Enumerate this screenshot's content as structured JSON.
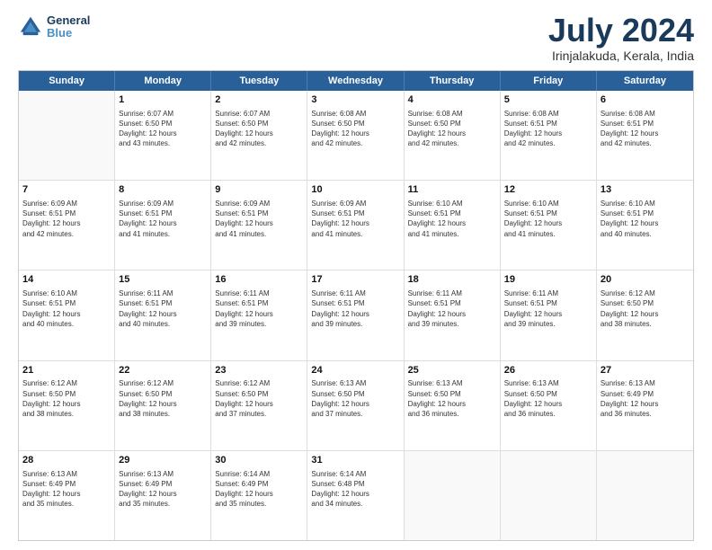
{
  "logo": {
    "line1": "General",
    "line2": "Blue"
  },
  "title": "July 2024",
  "subtitle": "Irinjalakuda, Kerala, India",
  "header_days": [
    "Sunday",
    "Monday",
    "Tuesday",
    "Wednesday",
    "Thursday",
    "Friday",
    "Saturday"
  ],
  "weeks": [
    [
      {
        "day": "",
        "sunrise": "",
        "sunset": "",
        "daylight": ""
      },
      {
        "day": "1",
        "sunrise": "Sunrise: 6:07 AM",
        "sunset": "Sunset: 6:50 PM",
        "daylight": "Daylight: 12 hours",
        "daylight2": "and 43 minutes."
      },
      {
        "day": "2",
        "sunrise": "Sunrise: 6:07 AM",
        "sunset": "Sunset: 6:50 PM",
        "daylight": "Daylight: 12 hours",
        "daylight2": "and 42 minutes."
      },
      {
        "day": "3",
        "sunrise": "Sunrise: 6:08 AM",
        "sunset": "Sunset: 6:50 PM",
        "daylight": "Daylight: 12 hours",
        "daylight2": "and 42 minutes."
      },
      {
        "day": "4",
        "sunrise": "Sunrise: 6:08 AM",
        "sunset": "Sunset: 6:50 PM",
        "daylight": "Daylight: 12 hours",
        "daylight2": "and 42 minutes."
      },
      {
        "day": "5",
        "sunrise": "Sunrise: 6:08 AM",
        "sunset": "Sunset: 6:51 PM",
        "daylight": "Daylight: 12 hours",
        "daylight2": "and 42 minutes."
      },
      {
        "day": "6",
        "sunrise": "Sunrise: 6:08 AM",
        "sunset": "Sunset: 6:51 PM",
        "daylight": "Daylight: 12 hours",
        "daylight2": "and 42 minutes."
      }
    ],
    [
      {
        "day": "7",
        "sunrise": "Sunrise: 6:09 AM",
        "sunset": "Sunset: 6:51 PM",
        "daylight": "Daylight: 12 hours",
        "daylight2": "and 42 minutes."
      },
      {
        "day": "8",
        "sunrise": "Sunrise: 6:09 AM",
        "sunset": "Sunset: 6:51 PM",
        "daylight": "Daylight: 12 hours",
        "daylight2": "and 41 minutes."
      },
      {
        "day": "9",
        "sunrise": "Sunrise: 6:09 AM",
        "sunset": "Sunset: 6:51 PM",
        "daylight": "Daylight: 12 hours",
        "daylight2": "and 41 minutes."
      },
      {
        "day": "10",
        "sunrise": "Sunrise: 6:09 AM",
        "sunset": "Sunset: 6:51 PM",
        "daylight": "Daylight: 12 hours",
        "daylight2": "and 41 minutes."
      },
      {
        "day": "11",
        "sunrise": "Sunrise: 6:10 AM",
        "sunset": "Sunset: 6:51 PM",
        "daylight": "Daylight: 12 hours",
        "daylight2": "and 41 minutes."
      },
      {
        "day": "12",
        "sunrise": "Sunrise: 6:10 AM",
        "sunset": "Sunset: 6:51 PM",
        "daylight": "Daylight: 12 hours",
        "daylight2": "and 41 minutes."
      },
      {
        "day": "13",
        "sunrise": "Sunrise: 6:10 AM",
        "sunset": "Sunset: 6:51 PM",
        "daylight": "Daylight: 12 hours",
        "daylight2": "and 40 minutes."
      }
    ],
    [
      {
        "day": "14",
        "sunrise": "Sunrise: 6:10 AM",
        "sunset": "Sunset: 6:51 PM",
        "daylight": "Daylight: 12 hours",
        "daylight2": "and 40 minutes."
      },
      {
        "day": "15",
        "sunrise": "Sunrise: 6:11 AM",
        "sunset": "Sunset: 6:51 PM",
        "daylight": "Daylight: 12 hours",
        "daylight2": "and 40 minutes."
      },
      {
        "day": "16",
        "sunrise": "Sunrise: 6:11 AM",
        "sunset": "Sunset: 6:51 PM",
        "daylight": "Daylight: 12 hours",
        "daylight2": "and 39 minutes."
      },
      {
        "day": "17",
        "sunrise": "Sunrise: 6:11 AM",
        "sunset": "Sunset: 6:51 PM",
        "daylight": "Daylight: 12 hours",
        "daylight2": "and 39 minutes."
      },
      {
        "day": "18",
        "sunrise": "Sunrise: 6:11 AM",
        "sunset": "Sunset: 6:51 PM",
        "daylight": "Daylight: 12 hours",
        "daylight2": "and 39 minutes."
      },
      {
        "day": "19",
        "sunrise": "Sunrise: 6:11 AM",
        "sunset": "Sunset: 6:51 PM",
        "daylight": "Daylight: 12 hours",
        "daylight2": "and 39 minutes."
      },
      {
        "day": "20",
        "sunrise": "Sunrise: 6:12 AM",
        "sunset": "Sunset: 6:50 PM",
        "daylight": "Daylight: 12 hours",
        "daylight2": "and 38 minutes."
      }
    ],
    [
      {
        "day": "21",
        "sunrise": "Sunrise: 6:12 AM",
        "sunset": "Sunset: 6:50 PM",
        "daylight": "Daylight: 12 hours",
        "daylight2": "and 38 minutes."
      },
      {
        "day": "22",
        "sunrise": "Sunrise: 6:12 AM",
        "sunset": "Sunset: 6:50 PM",
        "daylight": "Daylight: 12 hours",
        "daylight2": "and 38 minutes."
      },
      {
        "day": "23",
        "sunrise": "Sunrise: 6:12 AM",
        "sunset": "Sunset: 6:50 PM",
        "daylight": "Daylight: 12 hours",
        "daylight2": "and 37 minutes."
      },
      {
        "day": "24",
        "sunrise": "Sunrise: 6:13 AM",
        "sunset": "Sunset: 6:50 PM",
        "daylight": "Daylight: 12 hours",
        "daylight2": "and 37 minutes."
      },
      {
        "day": "25",
        "sunrise": "Sunrise: 6:13 AM",
        "sunset": "Sunset: 6:50 PM",
        "daylight": "Daylight: 12 hours",
        "daylight2": "and 36 minutes."
      },
      {
        "day": "26",
        "sunrise": "Sunrise: 6:13 AM",
        "sunset": "Sunset: 6:50 PM",
        "daylight": "Daylight: 12 hours",
        "daylight2": "and 36 minutes."
      },
      {
        "day": "27",
        "sunrise": "Sunrise: 6:13 AM",
        "sunset": "Sunset: 6:49 PM",
        "daylight": "Daylight: 12 hours",
        "daylight2": "and 36 minutes."
      }
    ],
    [
      {
        "day": "28",
        "sunrise": "Sunrise: 6:13 AM",
        "sunset": "Sunset: 6:49 PM",
        "daylight": "Daylight: 12 hours",
        "daylight2": "and 35 minutes."
      },
      {
        "day": "29",
        "sunrise": "Sunrise: 6:13 AM",
        "sunset": "Sunset: 6:49 PM",
        "daylight": "Daylight: 12 hours",
        "daylight2": "and 35 minutes."
      },
      {
        "day": "30",
        "sunrise": "Sunrise: 6:14 AM",
        "sunset": "Sunset: 6:49 PM",
        "daylight": "Daylight: 12 hours",
        "daylight2": "and 35 minutes."
      },
      {
        "day": "31",
        "sunrise": "Sunrise: 6:14 AM",
        "sunset": "Sunset: 6:48 PM",
        "daylight": "Daylight: 12 hours",
        "daylight2": "and 34 minutes."
      },
      {
        "day": "",
        "sunrise": "",
        "sunset": "",
        "daylight": "",
        "daylight2": ""
      },
      {
        "day": "",
        "sunrise": "",
        "sunset": "",
        "daylight": "",
        "daylight2": ""
      },
      {
        "day": "",
        "sunrise": "",
        "sunset": "",
        "daylight": "",
        "daylight2": ""
      }
    ]
  ]
}
